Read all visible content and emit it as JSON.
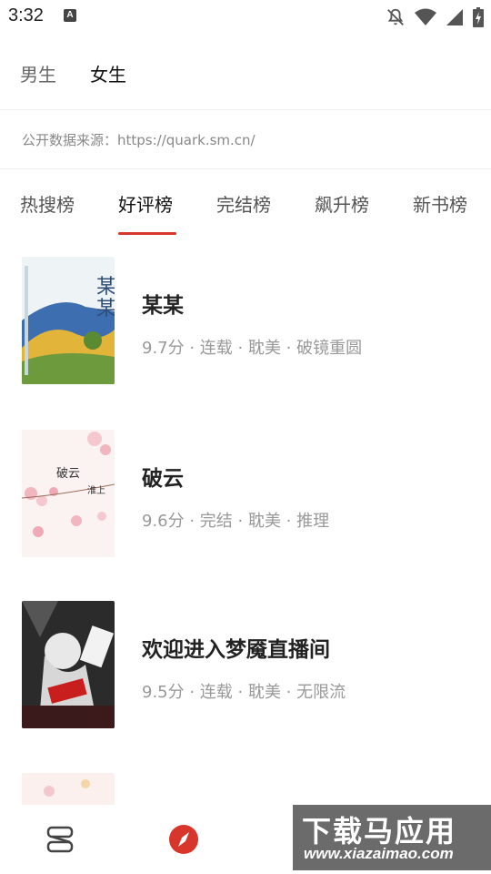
{
  "status_bar": {
    "time": "3:32",
    "notification_letter": "A"
  },
  "gender_tabs": [
    {
      "label": "男生",
      "active": false
    },
    {
      "label": "女生",
      "active": true
    }
  ],
  "source_text": "公开数据来源：https://quark.sm.cn/",
  "rank_tabs": [
    {
      "label": "热搜榜",
      "active": false
    },
    {
      "label": "好评榜",
      "active": true
    },
    {
      "label": "完结榜",
      "active": false
    },
    {
      "label": "飙升榜",
      "active": false
    },
    {
      "label": "新书榜",
      "active": false
    }
  ],
  "books": [
    {
      "title": "某某",
      "meta": "9.7分 · 连载 · 耽美 · 破镜重圆"
    },
    {
      "title": "破云",
      "meta": "9.6分 · 完结 · 耽美 · 推理",
      "cover_text": "破云",
      "cover_text2": "淮上"
    },
    {
      "title": "欢迎进入梦魇直播间",
      "meta": "9.5分 · 连载 · 耽美 · 无限流"
    },
    {
      "title": "",
      "meta": ""
    }
  ],
  "watermark": {
    "big": "下载马应用",
    "small": "www.xiazaimao.com"
  },
  "accent_color": "#d9362b"
}
